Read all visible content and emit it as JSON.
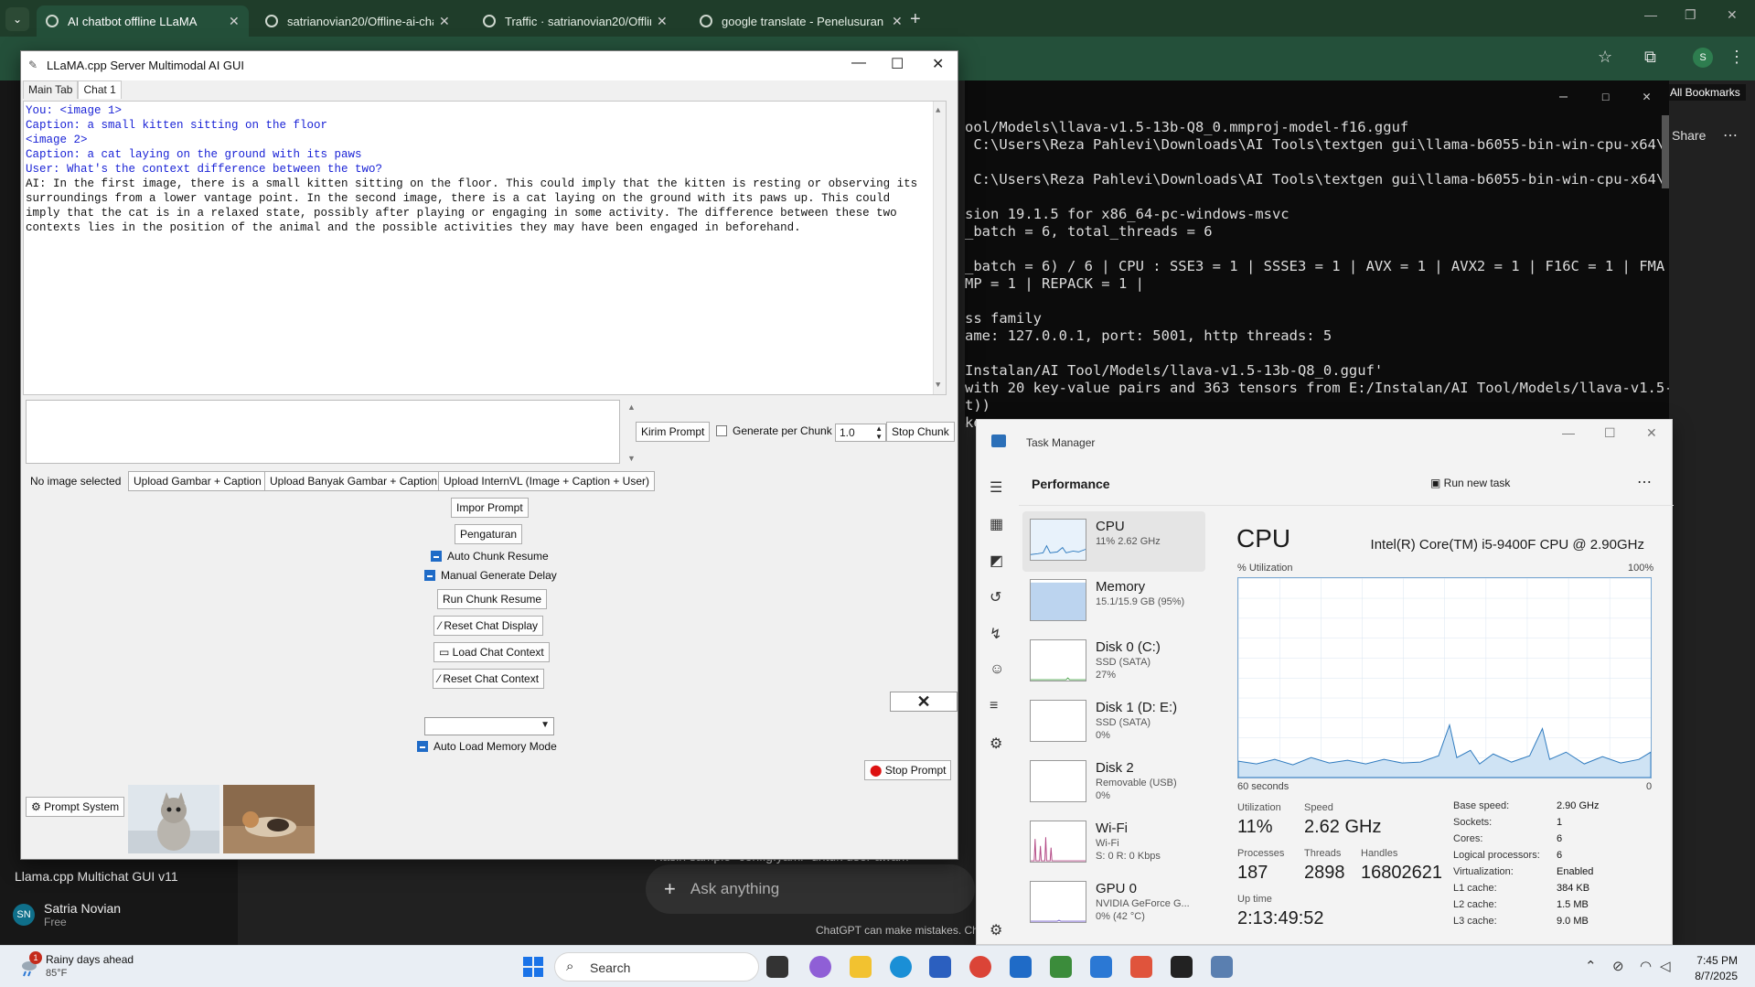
{
  "browser": {
    "tabs": [
      {
        "title": "AI chatbot offline LLaMA",
        "active": true
      },
      {
        "title": "satrianovian20/Offline-ai-chat-...",
        "active": false
      },
      {
        "title": "Traffic · satrianovian20/Offline-...",
        "active": false
      },
      {
        "title": "google translate - Penelusuran",
        "active": false
      }
    ],
    "bookmarks_label": "All Bookmarks",
    "profile_initial": "S"
  },
  "chatgpt": {
    "sidebar_title": "Llama.cpp Multichat GUI v11",
    "user_name": "Satria Novian",
    "user_plan": "Free",
    "user_initials": "SN",
    "share_label": "Share",
    "ask_placeholder": "Ask anything",
    "disclaimer": "ChatGPT can make mistakes. Che",
    "partial_text": "Kasih sample `config.yaml` untuk user awam"
  },
  "terminal": {
    "lines": [
      "ool/Models\\llava-v1.5-13b-Q8_0.mmproj-model-f16.gguf",
      " C:\\Users\\Reza Pahlevi\\Downloads\\AI Tools\\textgen gui\\llama-b6055-bin-win-cpu-x64\\g",
      "",
      " C:\\Users\\Reza Pahlevi\\Downloads\\AI Tools\\textgen gui\\llama-b6055-bin-win-cpu-x64\\g",
      "",
      "sion 19.1.5 for x86_64-pc-windows-msvc",
      "_batch = 6, total_threads = 6",
      "",
      "_batch = 6) / 6 | CPU : SSE3 = 1 | SSSE3 = 1 | AVX = 1 | AVX2 = 1 | F16C = 1 | FMA",
      "MP = 1 | REPACK = 1 |",
      "",
      "ss family",
      "ame: 127.0.0.1, port: 5001, http threads: 5",
      "",
      "Instalan/AI Tool/Models/llava-v1.5-13b-Q8_0.gguf'",
      "with 20 key-value pairs and 363 tensors from E:/Instalan/AI Tool/Models/llava-v1.5-",
      "t))",
      "ke"
    ]
  },
  "gui": {
    "title": "LLaMA.cpp Server Multimodal AI GUI",
    "tabs": [
      "Main Tab",
      "Chat 1"
    ],
    "chat_lines": [
      {
        "text": "You: <image 1>",
        "color": "#1a23d6"
      },
      {
        "text": "Caption: a small kitten sitting on the floor",
        "color": "#1a23d6"
      },
      {
        "text": "<image 2>",
        "color": "#1a23d6"
      },
      {
        "text": "Caption: a cat laying on the ground with its paws",
        "color": "#1a23d6"
      },
      {
        "text": "User: What's the context difference between the two?",
        "color": "#1a23d6"
      },
      {
        "text": "AI:  In the first image, there is a small kitten sitting on the floor. This could imply that the kitten is resting or observing its surroundings from a lower vantage point. In the second image, there is a cat laying on the ground with its paws up. This could imply that the cat is in a relaxed state, possibly after playing or engaging in some activity. The difference between these two contexts lies in the position of the animal and the possible activities they may have been engaged in beforehand.",
        "color": "#111111"
      }
    ],
    "send_button": "Kirim Prompt",
    "generate_per_chunk_label": "Generate per Chunk",
    "chunk_value": "1.0",
    "stop_chunk_button": "Stop Chunk",
    "no_image_label": "No image selected",
    "upload_buttons": [
      "Upload Gambar + Caption",
      "Upload Banyak Gambar + Caption",
      "Upload InternVL (Image + Caption + User)"
    ],
    "import_prompt": "Impor Prompt",
    "settings": "Pengaturan",
    "auto_chunk_resume": "Auto Chunk Resume",
    "manual_generate_delay": "Manual Generate Delay",
    "run_chunk_resume": "Run Chunk Resume",
    "reset_chat_display": "Reset Chat Display",
    "load_chat_context": "Load Chat Context",
    "reset_chat_context": "Reset Chat Context",
    "auto_load_memory": "Auto Load Memory Mode",
    "stop_prompt": "Stop Prompt",
    "prompt_system": "Prompt System"
  },
  "taskmanager": {
    "title": "Task Manager",
    "page": "Performance",
    "run_new_task": "Run new task",
    "resources": [
      {
        "name": "CPU",
        "line1": "11%  2.62 GHz",
        "line2": "",
        "color": "#2f7bbf"
      },
      {
        "name": "Memory",
        "line1": "15.1/15.9 GB (95%)",
        "line2": "",
        "color": "#8b5fb8"
      },
      {
        "name": "Disk 0 (C:)",
        "line1": "SSD (SATA)",
        "line2": "27%",
        "color": "#4aa34a"
      },
      {
        "name": "Disk 1 (D: E:)",
        "line1": "SSD (SATA)",
        "line2": "0%",
        "color": "#4aa34a"
      },
      {
        "name": "Disk 2",
        "line1": "Removable (USB)",
        "line2": "0%",
        "color": "#4aa34a"
      },
      {
        "name": "Wi-Fi",
        "line1": "Wi-Fi",
        "line2": "S: 0  R: 0 Kbps",
        "color": "#b34a86"
      },
      {
        "name": "GPU 0",
        "line1": "NVIDIA GeForce G...",
        "line2": "0% (42 °C)",
        "color": "#6f59c9"
      }
    ],
    "heading": "CPU",
    "cpu_name": "Intel(R) Core(TM) i5-9400F CPU @ 2.90GHz",
    "util_label": "% Utilization",
    "util_max": "100%",
    "axis_left": "60 seconds",
    "axis_right": "0",
    "stats": {
      "utilization_label": "Utilization",
      "utilization": "11%",
      "speed_label": "Speed",
      "speed": "2.62 GHz",
      "processes_label": "Processes",
      "processes": "187",
      "threads_label": "Threads",
      "threads": "2898",
      "handles_label": "Handles",
      "handles": "16802621",
      "uptime_label": "Up time",
      "uptime": "2:13:49:52"
    },
    "specs": [
      {
        "label": "Base speed:",
        "value": "2.90 GHz"
      },
      {
        "label": "Sockets:",
        "value": "1"
      },
      {
        "label": "Cores:",
        "value": "6"
      },
      {
        "label": "Logical processors:",
        "value": "6"
      },
      {
        "label": "Virtualization:",
        "value": "Enabled"
      },
      {
        "label": "L1 cache:",
        "value": "384 KB"
      },
      {
        "label": "L2 cache:",
        "value": "1.5 MB"
      },
      {
        "label": "L3 cache:",
        "value": "9.0 MB"
      }
    ]
  },
  "taskbar": {
    "weather_title": "Rainy days ahead",
    "weather_temp": "85°F",
    "notification_count": "1",
    "search_placeholder": "Search",
    "time": "7:45 PM",
    "date": "8/7/2025"
  }
}
